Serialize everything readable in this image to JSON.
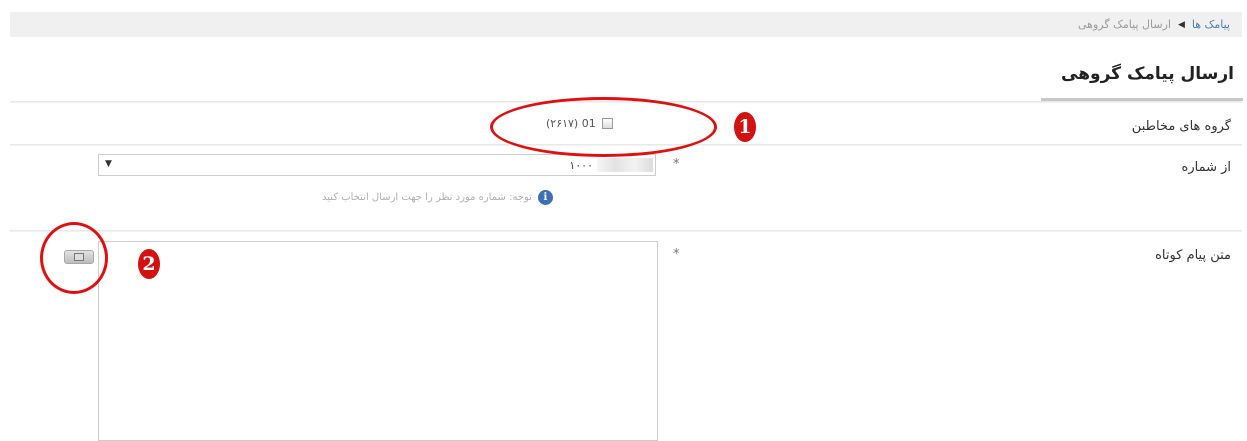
{
  "breadcrumb": {
    "parent": "پیامک ها",
    "separator": "◀",
    "current": "ارسال پیامک گروهی"
  },
  "page": {
    "title": "ارسال پیامک گروهی"
  },
  "form": {
    "contact_groups": {
      "label": "گروه های مخاطبن",
      "option_label": "(۲۶۱۷) 01"
    },
    "from_number": {
      "label": "از شماره",
      "required": "*",
      "selected_value": "۱۰۰۰",
      "hint": "توجه: شماره مورد نظر را جهت ارسال انتخاب کنید",
      "arrow": "▼"
    },
    "message_text": {
      "label": "متن پیام کوتاه",
      "required": "*"
    }
  },
  "annotations": {
    "one": "1",
    "two": "2",
    "color": "#e01010"
  },
  "icons": {
    "info": "info-icon",
    "toolbar": "template-icon"
  }
}
